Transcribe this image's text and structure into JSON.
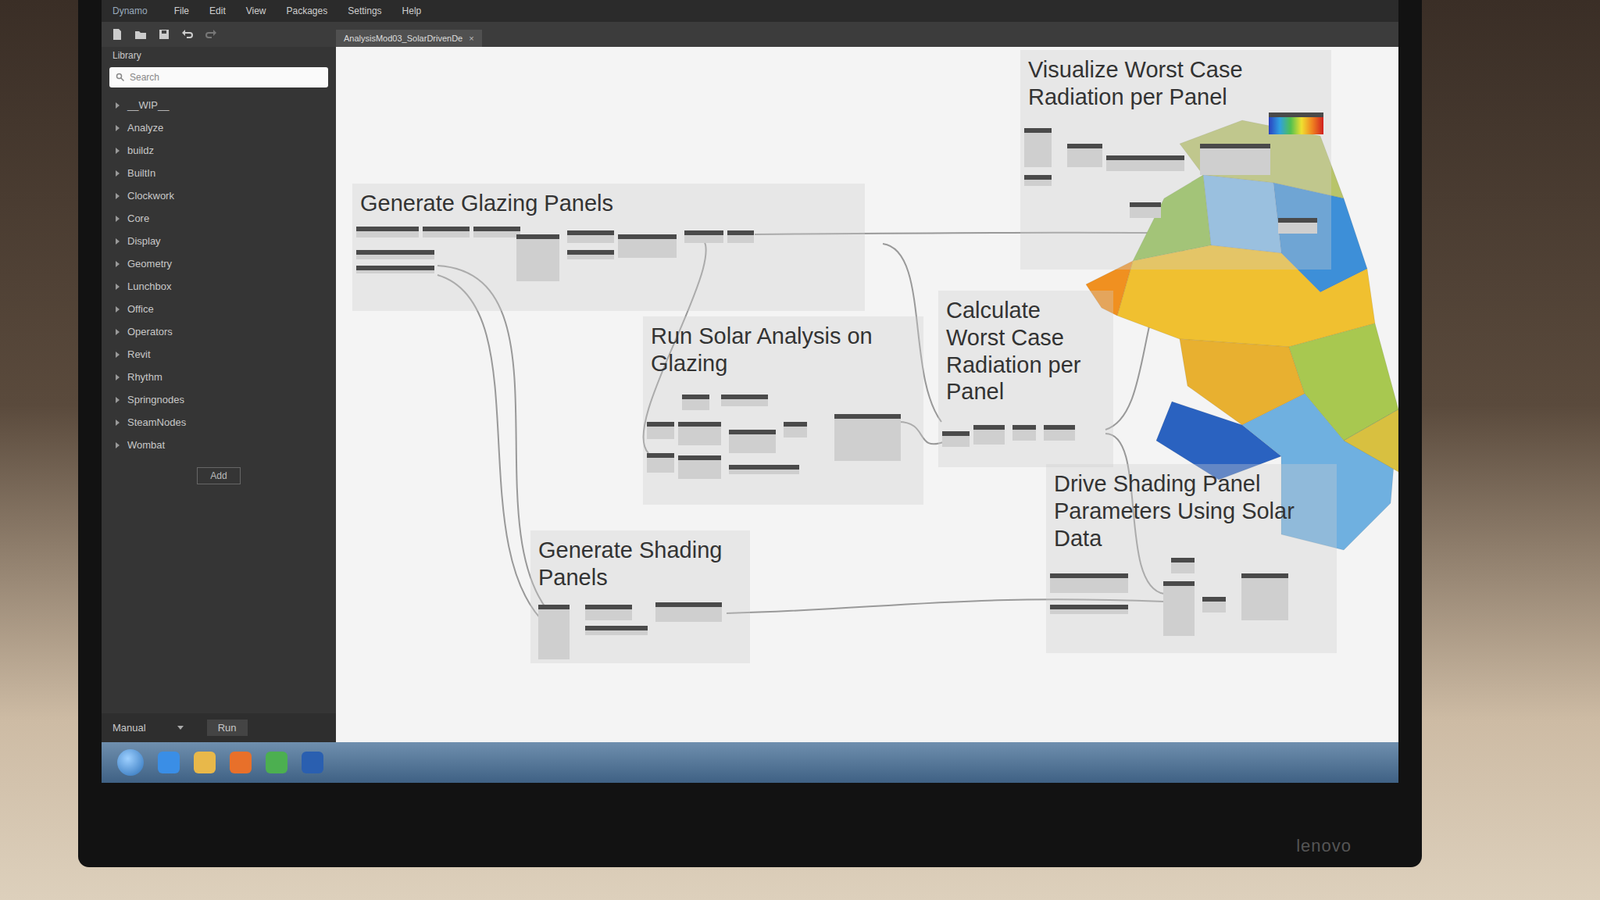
{
  "window": {
    "title": "Dynamo"
  },
  "menu": [
    "File",
    "Edit",
    "View",
    "Packages",
    "Settings",
    "Help"
  ],
  "library": {
    "title": "Library",
    "search": {
      "placeholder": "Search"
    },
    "items": [
      "__WIP__",
      "Analyze",
      "buildz",
      "BuiltIn",
      "Clockwork",
      "Core",
      "Display",
      "Geometry",
      "Lunchbox",
      "Office",
      "Operators",
      "Revit",
      "Rhythm",
      "Springnodes",
      "SteamNodes",
      "Wombat"
    ],
    "add_button": "Add"
  },
  "tab": {
    "label": "AnalysisMod03_SolarDrivenDe",
    "close": "×"
  },
  "groups": [
    {
      "title": "Generate Glazing Panels"
    },
    {
      "title": "Run Solar Analysis on Glazing"
    },
    {
      "title": "Calculate Worst Case Radiation per Panel"
    },
    {
      "title": "Generate Shading Panels"
    },
    {
      "title": "Visualize Worst Case Radiation per Panel"
    },
    {
      "title": "Drive Shading Panel Parameters Using Solar Data"
    }
  ],
  "run_bar": {
    "mode": "Manual",
    "button": "Run"
  },
  "monitor": {
    "brand": "lenovo"
  }
}
